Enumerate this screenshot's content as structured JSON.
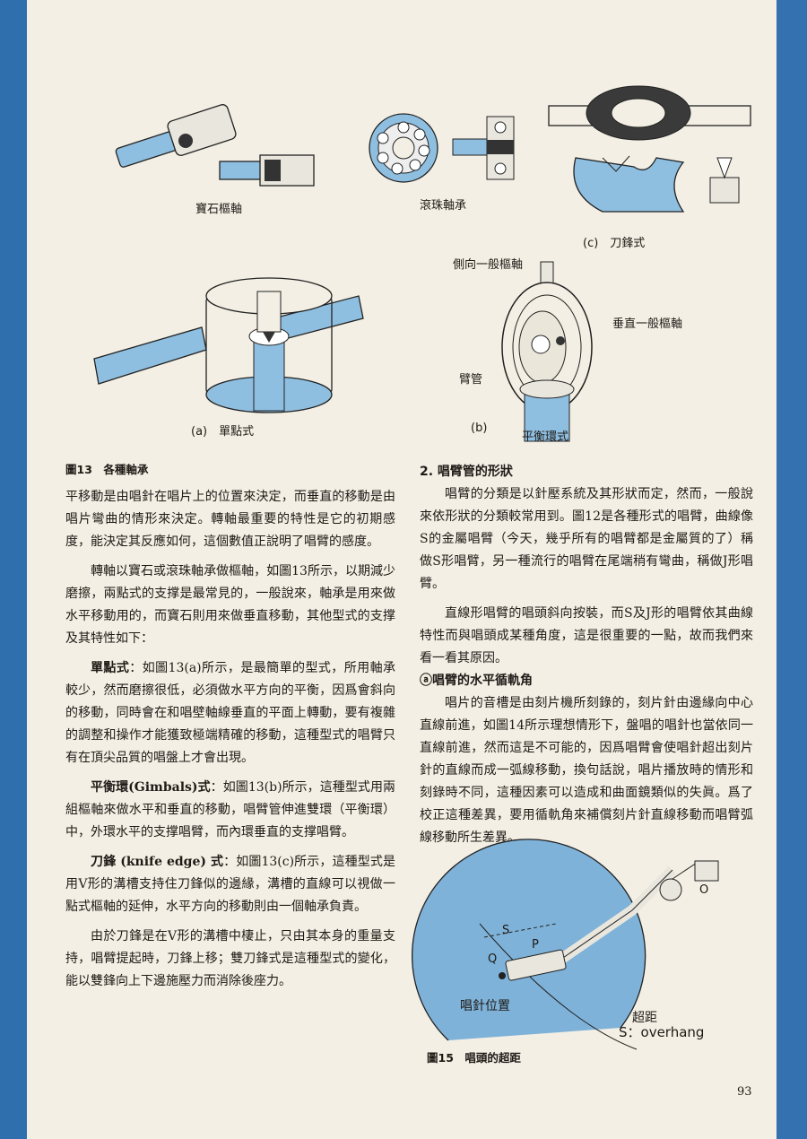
{
  "figure13": {
    "label_jewel": "寶石樞軸",
    "label_ball": "滾珠軸承",
    "label_c": "(c)　刀鋒式",
    "label_a": "(a)　單點式",
    "label_b": "(b)",
    "label_gimbal": "平衡環式",
    "label_side_pivot": "側向一般樞軸",
    "label_vertical_pivot": "垂直一般樞軸",
    "label_arm_tube": "臂管",
    "caption": "圖13　各種軸承"
  },
  "left_column": {
    "p1": "平移動是由唱針在唱片上的位置來決定，而垂直的移動是由唱片彎曲的情形來決定。轉軸最重要的特性是它的初期感度，能決定其反應如何，這個數值正說明了唱臂的感度。",
    "p2": "轉軸以寶石或滾珠軸承做樞軸，如圖13所示，以期減少磨擦，兩點式的支撑是最常見的，一般說來，軸承是用來做水平移動用的，而寶石則用來做垂直移動，其他型式的支撑及其特性如下：",
    "p3_term": "單點式",
    "p3": "：如圖13(a)所示，是最簡單的型式，所用軸承較少，然而磨擦很低，必須做水平方向的平衡，因爲會斜向的移動，同時會在和唱壁軸線垂直的平面上轉動，要有複雜的調整和操作才能獲致極端精確的移動，這種型式的唱臂只有在頂尖品質的唱盤上才會出現。",
    "p4_term": "平衡環(Gimbals)式",
    "p4": "：如圖13(b)所示，這種型式用兩組樞軸來做水平和垂直的移動，唱臂管伸進雙環（平衡環）中，外環水平的支撑唱臂，而內環垂直的支撑唱臂。",
    "p5_term": "刀鋒 (knife edge) 式",
    "p5": "：如圖13(c)所示，這種型式是用V形的溝槽支持住刀鋒似的邊緣，溝槽的直線可以視做一點式樞軸的延伸，水平方向的移動則由一個軸承負責。",
    "p6": "由於刀鋒是在V形的溝槽中棲止，只由其本身的重量支持，唱臂提起時，刀鋒上移；雙刀鋒式是這種型式的變化，能以雙鋒向上下邊施壓力而消除後座力。"
  },
  "right_column": {
    "section_title": "2. 唱臂管的形狀",
    "p1": "唱臂的分類是以針壓系統及其形狀而定，然而，一般說來依形狀的分類較常用到。圖12是各種形式的唱臂，曲線像S的金屬唱臂（今天，幾乎所有的唱臂都是金屬質的了）稱做S形唱臂，另一種流行的唱臂在尾端稍有彎曲，稱做J形唱臂。",
    "p2": "直線形唱臂的唱頭斜向按裝，而S及J形的唱臂依其曲線特性而與唱頭成某種角度，這是很重要的一點，故而我們來看一看其原因。",
    "sub_title": "ⓐ唱臂的水平循軌角",
    "p3": "唱片的音槽是由刻片機所刻錄的，刻片針由邊緣向中心直線前進，如圖14所示理想情形下，盤唱的唱針也當依同一直線前進，然而這是不可能的，因爲唱臂會使唱針超出刻片針的直線而成一弧線移動，換句話說，唱片播放時的情形和刻錄時不同，這種因素可以造成和曲面鏡類似的失眞。爲了校正這種差異，要用循軌角來補償刻片針直線移動而唱臂弧線移動所生差異。"
  },
  "figure15": {
    "label_s": "S",
    "label_p": "P",
    "label_q": "Q",
    "label_o": "O",
    "label_stylus": "唱針位置",
    "label_overhang_cn": "超距",
    "label_overhang_en": "S：overhang",
    "caption": "圖15　唱頭的超距"
  },
  "page_number": "93",
  "colors": {
    "paper": "#f3efe4",
    "accent_blue": "#7fb2d8",
    "border_blue": "#2f6fae"
  }
}
